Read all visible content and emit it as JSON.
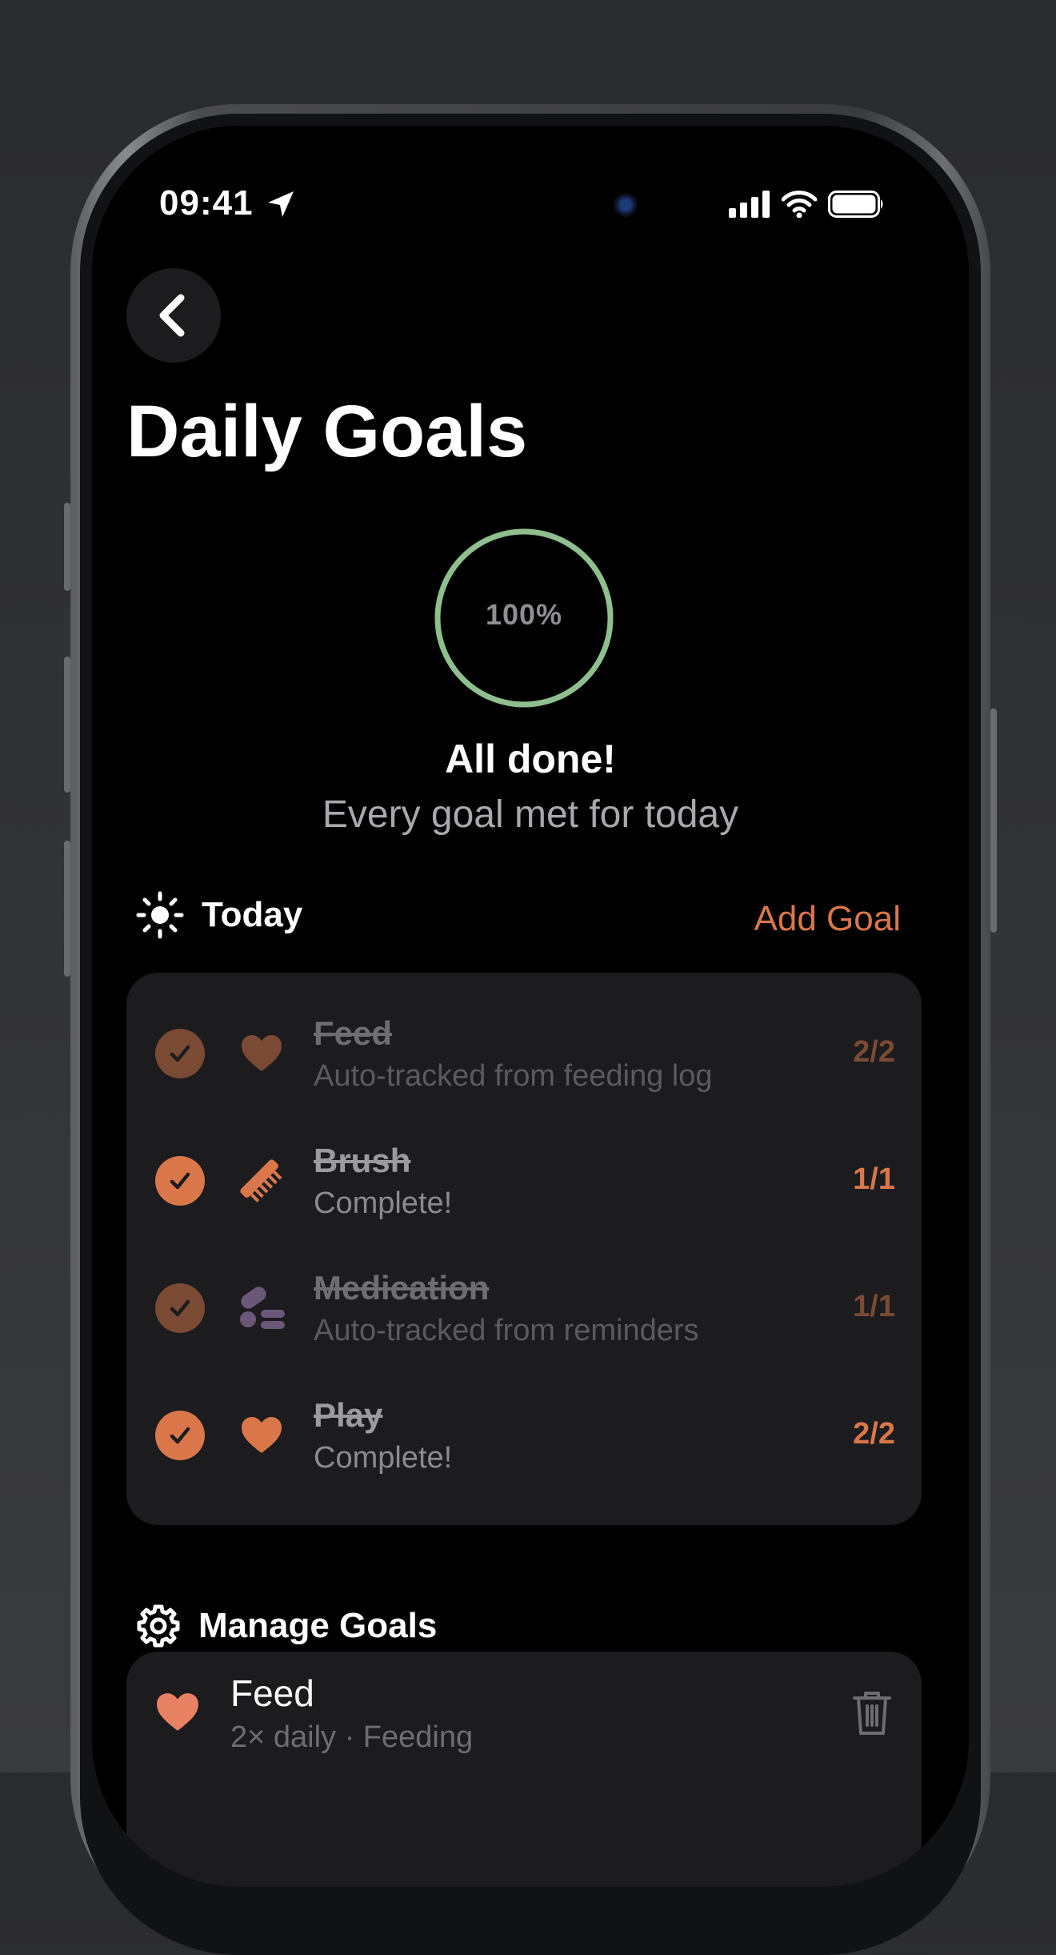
{
  "status_bar": {
    "time": "09:41"
  },
  "header": {
    "back_icon": "chevron-left-icon",
    "title": "Daily Goals"
  },
  "progress": {
    "percent_label": "100%",
    "fraction": 1.0,
    "ring_color": "#8fbf8f"
  },
  "summary": {
    "title": "All done!",
    "subtitle": "Every goal met for today"
  },
  "today": {
    "icon": "sun-icon",
    "label": "Today",
    "add_label": "Add Goal",
    "goals": [
      {
        "name": "Feed",
        "subtitle": "Auto-tracked from feeding log",
        "count": "2/2",
        "icon": "heart-icon",
        "style": "dim"
      },
      {
        "name": "Brush",
        "subtitle": "Complete!",
        "count": "1/1",
        "icon": "comb-icon",
        "style": "bright"
      },
      {
        "name": "Medication",
        "subtitle": "Auto-tracked from reminders",
        "count": "1/1",
        "icon": "pills-icon",
        "style": "dim"
      },
      {
        "name": "Play",
        "subtitle": "Complete!",
        "count": "2/2",
        "icon": "heart-icon",
        "style": "bright"
      }
    ]
  },
  "manage": {
    "icon": "gear-icon",
    "label": "Manage Goals",
    "items": [
      {
        "name": "Feed",
        "subtitle": "2× daily · Feeding",
        "icon": "heart-icon",
        "action_icon": "trash-icon"
      }
    ]
  },
  "colors": {
    "accent": "#d9774b",
    "accent_dim": "#7a4a35",
    "card": "#1c1c1e",
    "success_ring": "#8fbf8f"
  }
}
